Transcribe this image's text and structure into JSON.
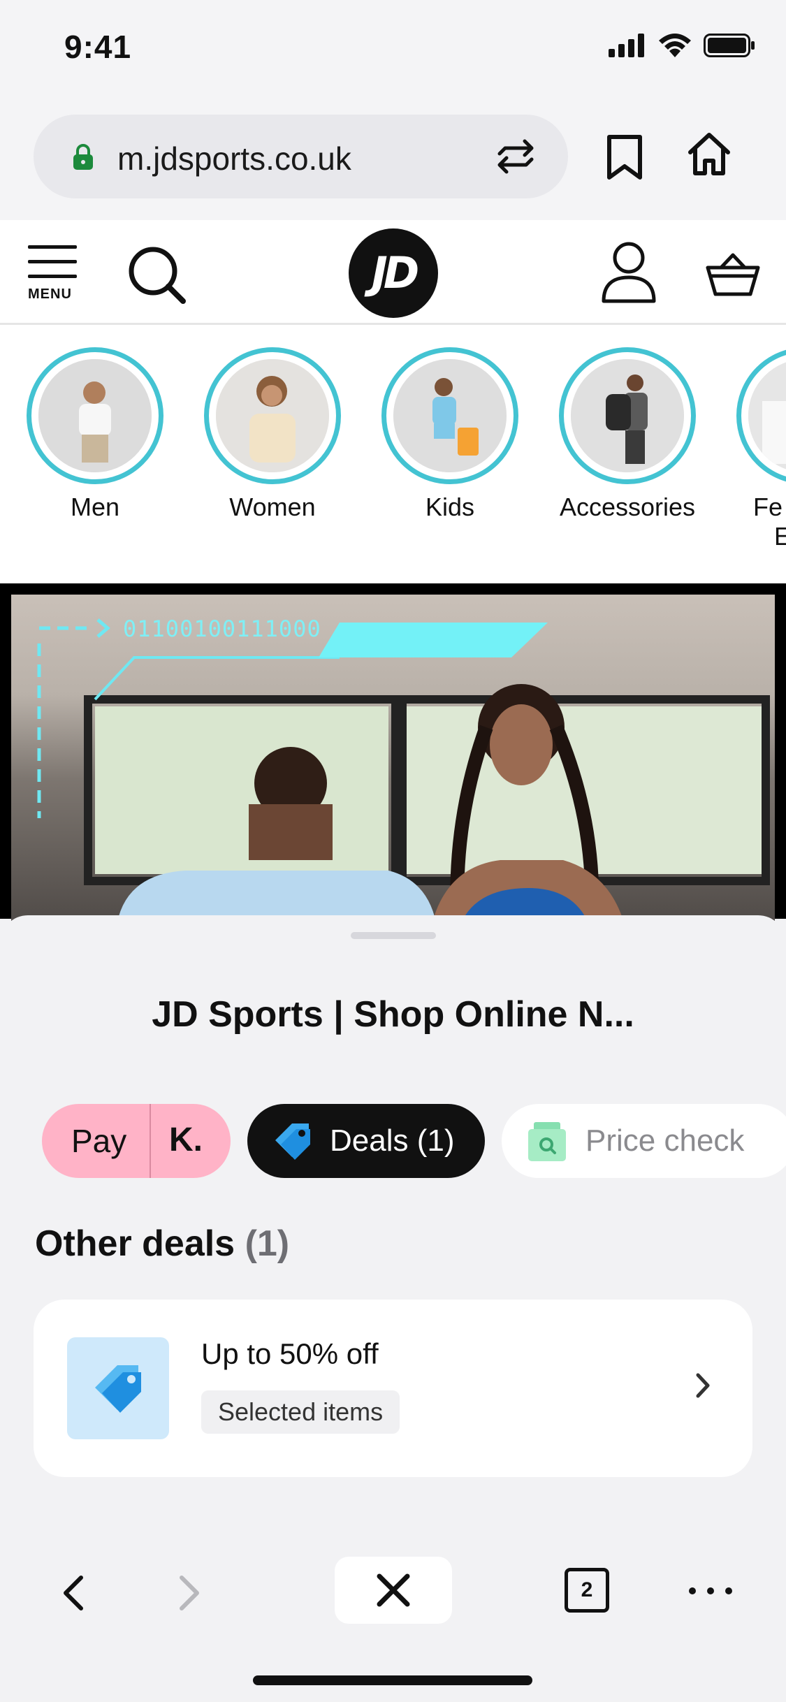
{
  "status_bar": {
    "time": "9:41",
    "icons": [
      "signal-icon",
      "wifi-icon",
      "battery-icon"
    ]
  },
  "browser": {
    "url": "m.jdsports.co.uk",
    "icons": [
      "lock-icon",
      "translate-swap-icon",
      "bookmark-icon",
      "home-icon"
    ]
  },
  "site_header": {
    "menu_label": "MENU",
    "logo_text": "JD",
    "icons": [
      "search-icon",
      "account-icon",
      "basket-icon"
    ]
  },
  "categories": [
    {
      "label": "Men"
    },
    {
      "label": "Women"
    },
    {
      "label": "Kids"
    },
    {
      "label": "Accessories"
    },
    {
      "label": "Fe",
      "label_line2": "E"
    }
  ],
  "hero": {
    "code_text": "01100100111000"
  },
  "sheet": {
    "title": "JD Sports | Shop Online N...",
    "chips": {
      "klarna_pay": "Pay",
      "klarna_logo": "K.",
      "deals": "Deals (1)",
      "price_check": "Price check"
    },
    "other_deals_label": "Other deals",
    "other_deals_count": "(1)",
    "deal": {
      "title": "Up to 50% off",
      "tag": "Selected items"
    }
  },
  "toolbar": {
    "tabs_count": "2"
  },
  "colors": {
    "accent_ring": "#43c3d2",
    "klarna_pink": "#ffb3c7",
    "deals_black": "#111111",
    "tag_blue": "#3aa8ee"
  }
}
